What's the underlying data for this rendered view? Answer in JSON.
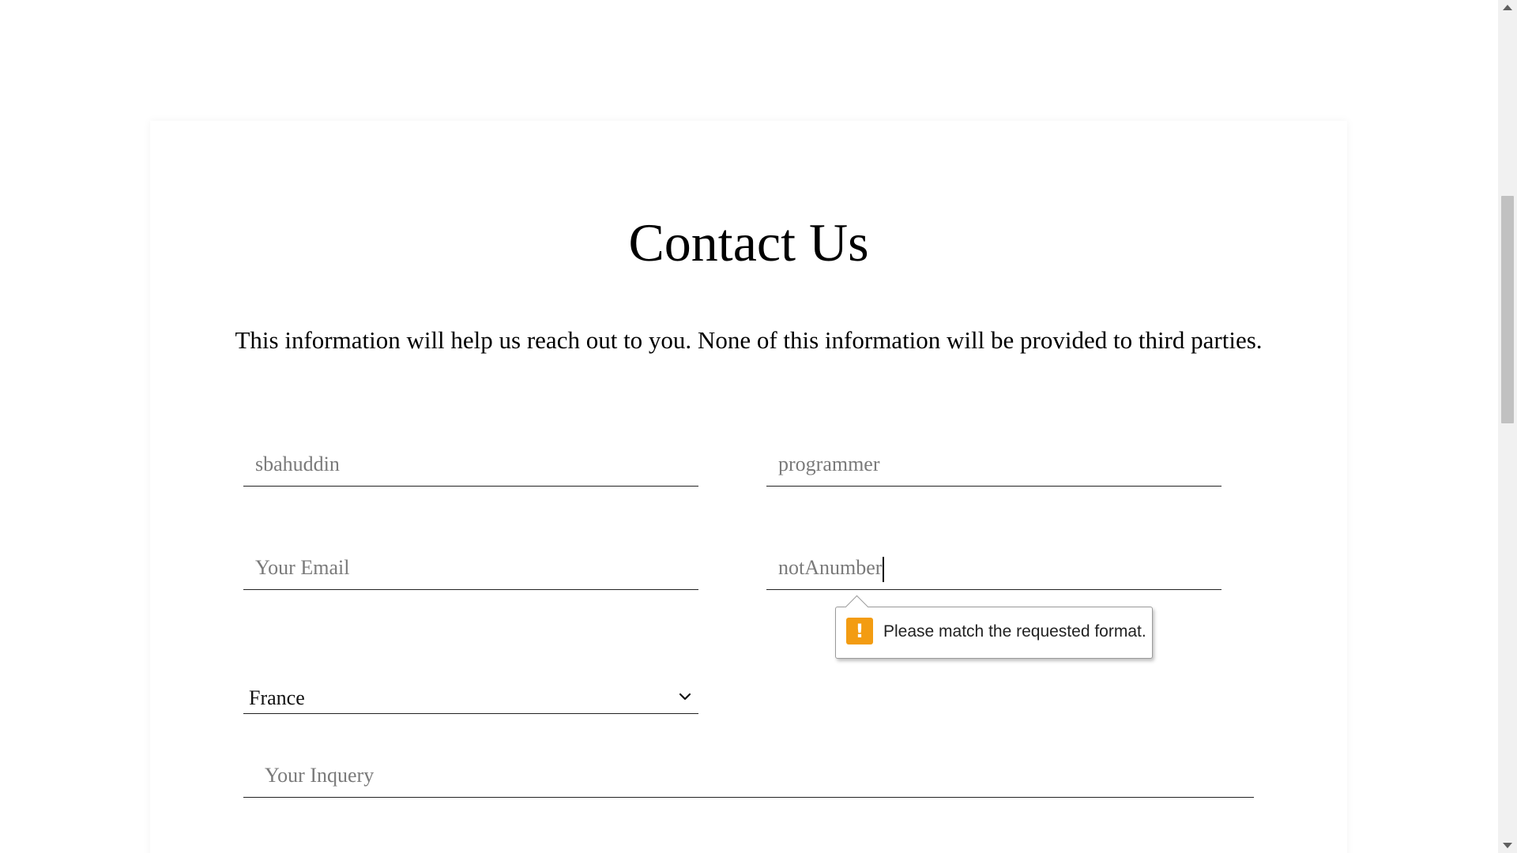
{
  "page": {
    "title": "Contact Us",
    "subtitle": "This information will help us reach out to you. None of this information will be provided to third parties."
  },
  "form": {
    "first_name": {
      "value": "sbahuddin"
    },
    "last_name": {
      "value": "programmer"
    },
    "email": {
      "placeholder": "Your Email"
    },
    "phone": {
      "value": "notAnumber"
    },
    "country": {
      "selected": "France"
    },
    "inquiry": {
      "placeholder": "Your Inquery"
    }
  },
  "validation_tooltip": {
    "icon": "warning-icon",
    "message": "Please match the requested format.",
    "accent": "#f39c12"
  },
  "scrollbar": {
    "icon_up": "scroll-up-arrow-icon",
    "icon_down": "scroll-down-arrow-icon"
  }
}
